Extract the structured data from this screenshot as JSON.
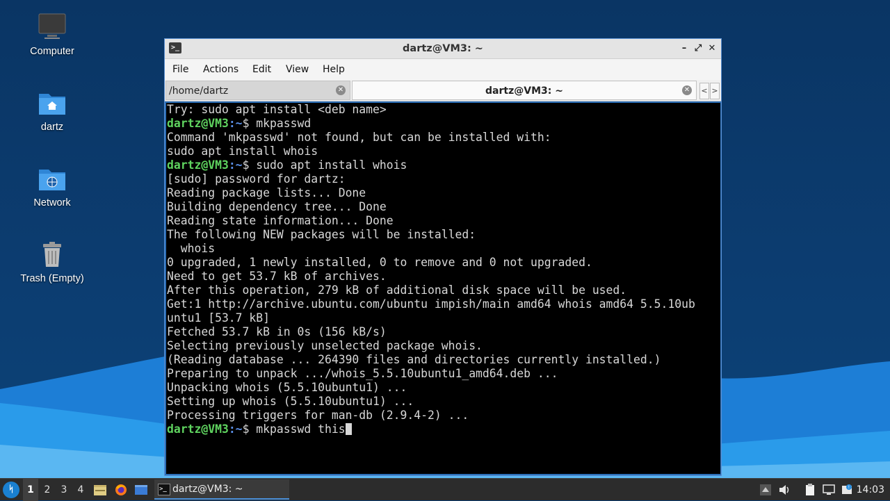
{
  "desktop": {
    "icons": [
      {
        "label": "Computer",
        "icon": "computer-icon"
      },
      {
        "label": "dartz",
        "icon": "home-folder-icon"
      },
      {
        "label": "Network",
        "icon": "network-folder-icon"
      },
      {
        "label": "Trash (Empty)",
        "icon": "trash-icon"
      }
    ]
  },
  "window": {
    "title": "dartz@VM3: ~",
    "controls": {
      "minimize": "–",
      "maximize": "⤢",
      "close": "✕"
    },
    "menu": [
      "File",
      "Actions",
      "Edit",
      "View",
      "Help"
    ],
    "tabs": [
      {
        "label": "/home/dartz",
        "active": false
      },
      {
        "label": "dartz@VM3: ~",
        "active": true
      }
    ],
    "tab_nav": {
      "prev": "<",
      "next": ">"
    }
  },
  "terminal": {
    "prompt_user": "dartz@VM3",
    "prompt_path": ":~",
    "prompt_symbol": "$",
    "lines": [
      {
        "type": "out",
        "text": "Try: sudo apt install <deb name>"
      },
      {
        "type": "cmd",
        "text": " mkpasswd"
      },
      {
        "type": "out",
        "text": "Command 'mkpasswd' not found, but can be installed with:"
      },
      {
        "type": "out",
        "text": "sudo apt install whois"
      },
      {
        "type": "cmd",
        "text": " sudo apt install whois"
      },
      {
        "type": "out",
        "text": "[sudo] password for dartz:"
      },
      {
        "type": "out",
        "text": "Reading package lists... Done"
      },
      {
        "type": "out",
        "text": "Building dependency tree... Done"
      },
      {
        "type": "out",
        "text": "Reading state information... Done"
      },
      {
        "type": "out",
        "text": "The following NEW packages will be installed:"
      },
      {
        "type": "out",
        "text": "  whois"
      },
      {
        "type": "out",
        "text": "0 upgraded, 1 newly installed, 0 to remove and 0 not upgraded."
      },
      {
        "type": "out",
        "text": "Need to get 53.7 kB of archives."
      },
      {
        "type": "out",
        "text": "After this operation, 279 kB of additional disk space will be used."
      },
      {
        "type": "out",
        "text": "Get:1 http://archive.ubuntu.com/ubuntu impish/main amd64 whois amd64 5.5.10ub"
      },
      {
        "type": "out",
        "text": "untu1 [53.7 kB]"
      },
      {
        "type": "out",
        "text": "Fetched 53.7 kB in 0s (156 kB/s)"
      },
      {
        "type": "out",
        "text": "Selecting previously unselected package whois."
      },
      {
        "type": "out",
        "text": "(Reading database ... 264390 files and directories currently installed.)"
      },
      {
        "type": "out",
        "text": "Preparing to unpack .../whois_5.5.10ubuntu1_amd64.deb ..."
      },
      {
        "type": "out",
        "text": "Unpacking whois (5.5.10ubuntu1) ..."
      },
      {
        "type": "out",
        "text": "Setting up whois (5.5.10ubuntu1) ..."
      },
      {
        "type": "out",
        "text": "Processing triggers for man-db (2.9.4-2) ..."
      }
    ],
    "current_input": " mkpasswd this"
  },
  "taskbar": {
    "workspaces": [
      "1",
      "2",
      "3",
      "4"
    ],
    "active_workspace": "1",
    "task_label": "dartz@VM3: ~",
    "clock": "14:03"
  },
  "colors": {
    "prompt_user": "#5fd35f",
    "prompt_path": "#5a8fe6",
    "accent": "#2b6fb9"
  }
}
